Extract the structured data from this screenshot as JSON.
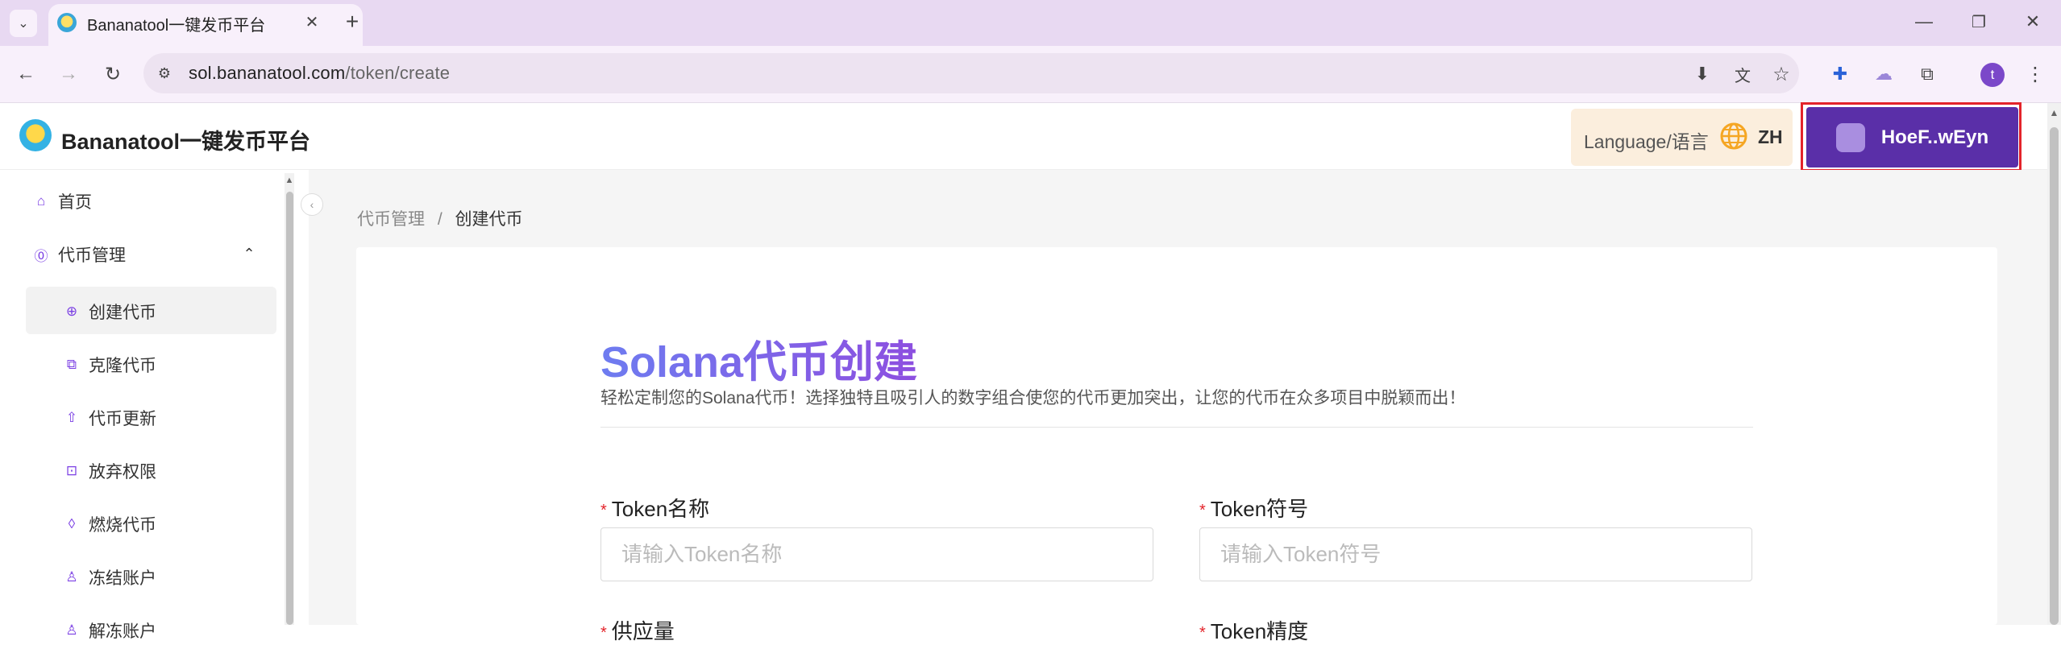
{
  "browser": {
    "tab_title": "Bananatool一键发币平台",
    "url_host": "sol.bananatool.com",
    "url_path": "/token/create",
    "profile_initial": "t"
  },
  "header": {
    "brand": "Bananatool一键发币平台",
    "language_label": "Language/语言",
    "language_code": "ZH",
    "wallet_address": "HoeF..wEyn"
  },
  "sidebar": {
    "items": [
      {
        "label": "首页"
      },
      {
        "label": "代币管理"
      },
      {
        "label": "创建代币"
      },
      {
        "label": "克隆代币"
      },
      {
        "label": "代币更新"
      },
      {
        "label": "放弃权限"
      },
      {
        "label": "燃烧代币"
      },
      {
        "label": "冻结账户"
      },
      {
        "label": "解冻账户"
      }
    ]
  },
  "breadcrumb": {
    "parent": "代币管理",
    "separator": "/",
    "current": "创建代币"
  },
  "form": {
    "title": "Solana代币创建",
    "subtitle": "轻松定制您的Solana代币！选择独特且吸引人的数字组合使您的代币更加突出，让您的代币在众多项目中脱颖而出！",
    "name_label": "Token名称",
    "name_placeholder": "请输入Token名称",
    "symbol_label": "Token符号",
    "symbol_placeholder": "请输入Token符号",
    "supply_label": "供应量",
    "decimals_label": "Token精度",
    "required_mark": "*"
  },
  "colors": {
    "accent": "#5a2fa8",
    "highlight": "#e3232a",
    "tab_bar": "#e8d9f2"
  }
}
